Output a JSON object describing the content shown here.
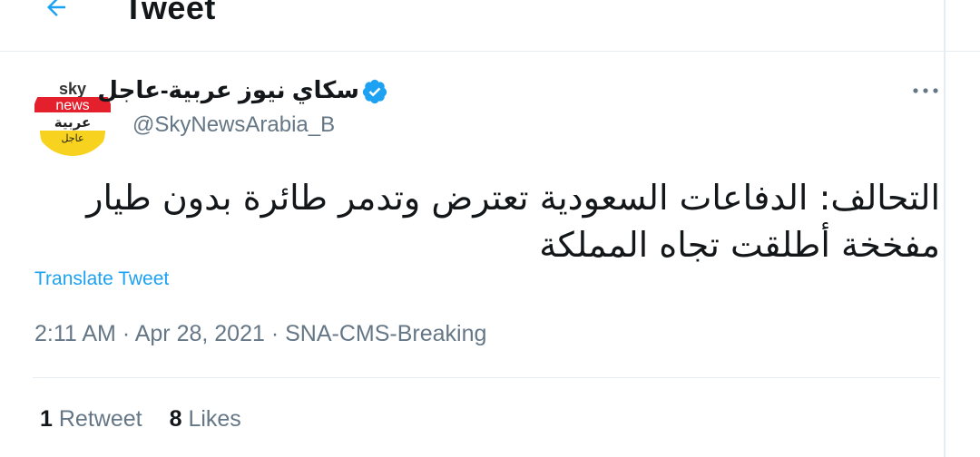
{
  "header": {
    "title": "Tweet",
    "back_icon": "arrow-left-icon"
  },
  "tweet": {
    "author_name": "سكاي نيوز عربية-عاجل",
    "verified": true,
    "handle": "@SkyNewsArabia_B",
    "avatar_text": {
      "line1": "sky",
      "line2": "news",
      "line3": "عربية",
      "line4": "عاجل"
    },
    "text_line1": "التحالف: الدفاعات السعودية تعترض وتدمر طائرة بدون طيار",
    "text_line2": "مفخخة أطلقت تجاه المملكة",
    "translate_label": "Translate Tweet",
    "time": "2:11 AM",
    "date": "Apr 28, 2021",
    "source": "SNA-CMS-Breaking",
    "separator": " · ",
    "retweet_count": "1",
    "retweet_label": "Retweet",
    "like_count": "8",
    "like_label": "Likes"
  },
  "colors": {
    "accent": "#1da1f2",
    "text_primary": "#14171a",
    "text_secondary": "#657786",
    "border": "#e6ecf0",
    "sky_red": "#e4202c",
    "sky_yellow": "#f7d21e"
  }
}
